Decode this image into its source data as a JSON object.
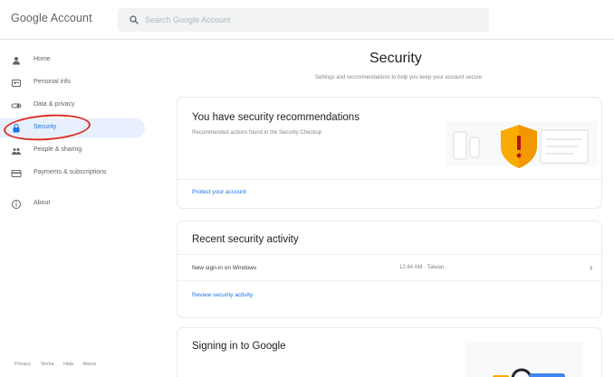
{
  "header": {
    "logo": "Google Account",
    "search_placeholder": "Search Google Account"
  },
  "sidebar": {
    "items": [
      {
        "label": "Home",
        "icon": "home-icon"
      },
      {
        "label": "Personal info",
        "icon": "person-icon"
      },
      {
        "label": "Data & privacy",
        "icon": "toggle-icon"
      },
      {
        "label": "Security",
        "icon": "lock-icon",
        "active": true
      },
      {
        "label": "People & sharing",
        "icon": "people-icon"
      },
      {
        "label": "Payments & subscriptions",
        "icon": "card-icon"
      },
      {
        "label": "About",
        "icon": "info-icon"
      }
    ],
    "footer": [
      "Privacy",
      "Terms",
      "Help",
      "About"
    ]
  },
  "main": {
    "title": "Security",
    "subtitle": "Settings and recommendations to help you keep your account secure",
    "recommendations": {
      "title": "You have security recommendations",
      "description": "Recommended actions found in the Security Checkup",
      "link": "Protect your account"
    },
    "activity": {
      "title": "Recent security activity",
      "event": "New sign-in on Windows",
      "time": "12:44 AM · Taiwan",
      "link": "Review security activity"
    },
    "signing": {
      "title": "Signing in to Google"
    }
  },
  "colors": {
    "accent": "#1a73e8",
    "active_bg": "#e8f0fe",
    "shield": "#f9ab00",
    "highlight": "#d93025"
  }
}
